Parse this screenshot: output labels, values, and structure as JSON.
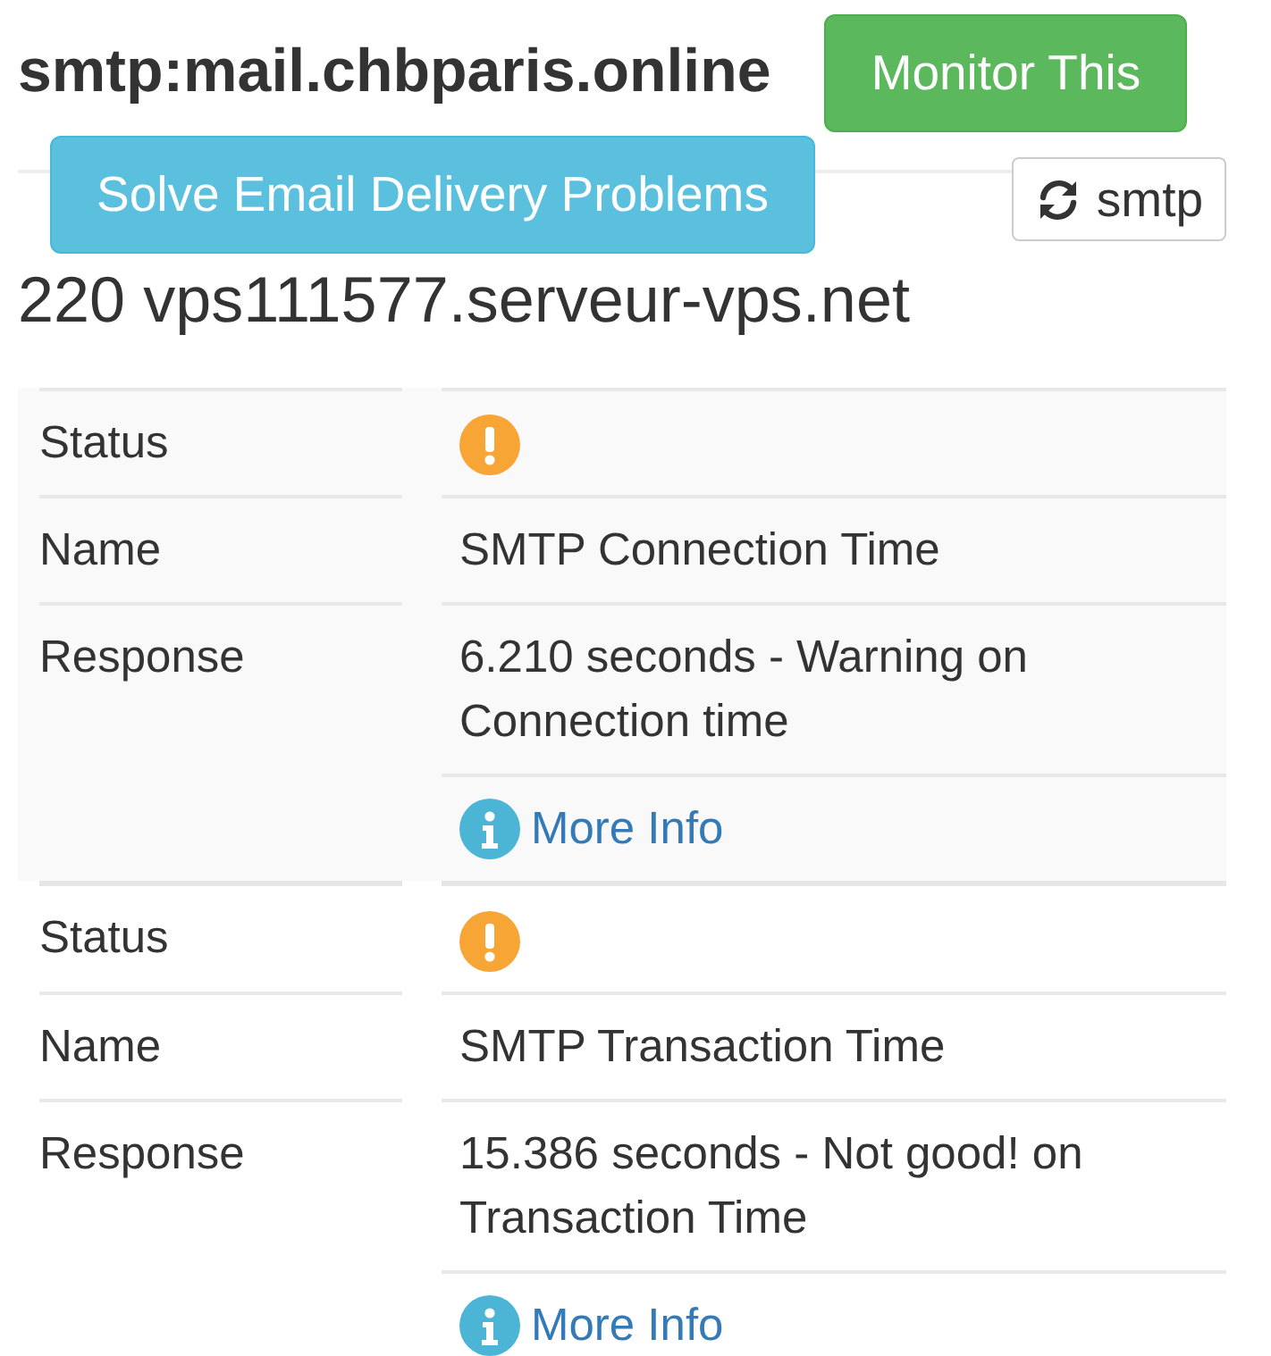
{
  "header": {
    "title": "smtp:mail.chbparis.online",
    "monitor_button": "Monitor This",
    "solve_button": "Solve Email Delivery Problems",
    "refresh_button": "smtp",
    "banner": "220 vps111577.serveur-vps.net"
  },
  "results": [
    {
      "status_label": "Status",
      "warning": true,
      "name_label": "Name",
      "name": "SMTP Connection Time",
      "response_label": "Response",
      "response": "6.210 seconds - Warning on Connection time",
      "link": "More Info"
    },
    {
      "status_label": "Status",
      "warning": true,
      "name_label": "Name",
      "name": "SMTP Transaction Time",
      "response_label": "Response",
      "response": "15.386 seconds - Not good! on Transaction Time",
      "link": "More Info"
    }
  ]
}
